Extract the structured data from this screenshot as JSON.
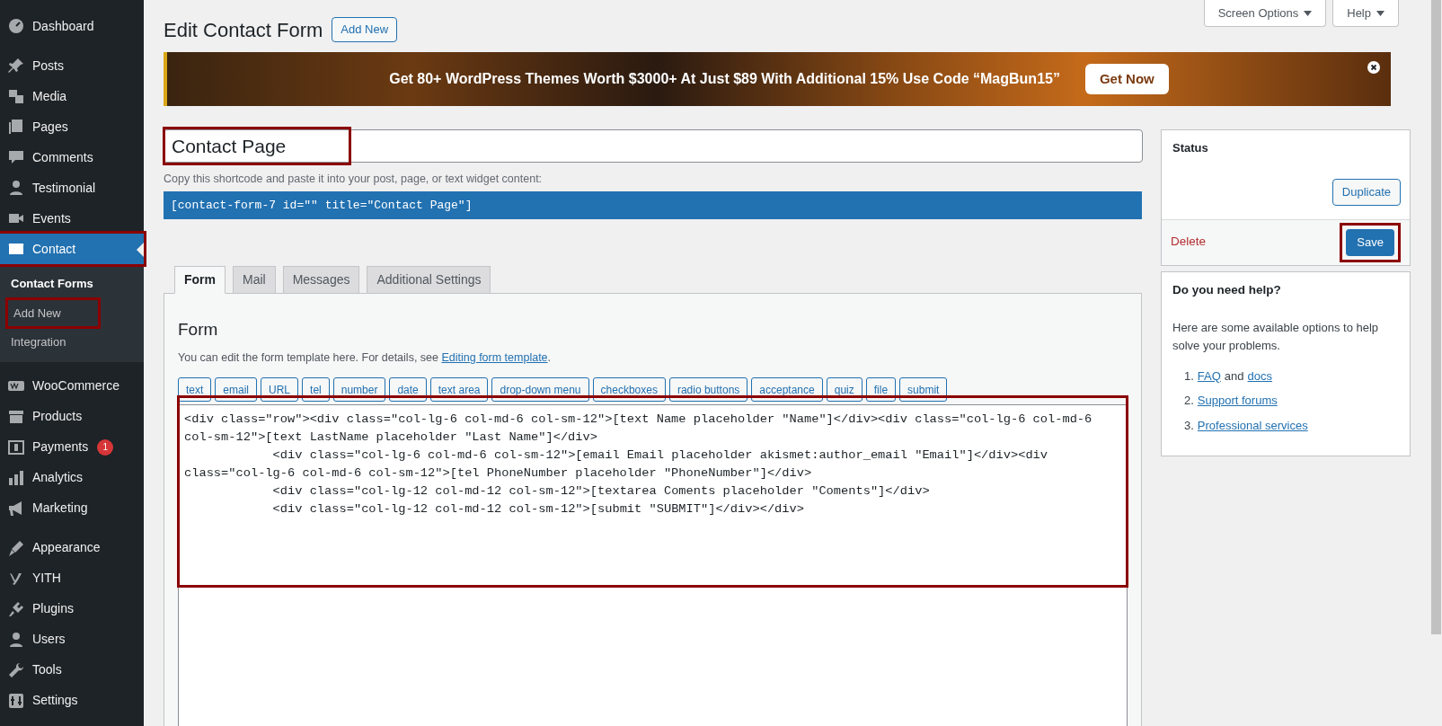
{
  "sidebar": {
    "groups": [
      [
        {
          "label": "Dashboard",
          "selected": false,
          "highlighted": false
        }
      ],
      [
        {
          "label": "Posts",
          "selected": false,
          "highlighted": false
        },
        {
          "label": "Media",
          "selected": false,
          "highlighted": false
        },
        {
          "label": "Pages",
          "selected": false,
          "highlighted": false
        },
        {
          "label": "Comments",
          "selected": false,
          "highlighted": false
        },
        {
          "label": "Testimonial",
          "selected": false,
          "highlighted": false
        },
        {
          "label": "Events",
          "selected": false,
          "highlighted": false
        },
        {
          "label": "Contact",
          "selected": true,
          "highlighted": true,
          "children": [
            {
              "label": "Contact Forms",
              "selected": true,
              "highlighted": false
            },
            {
              "label": "Add New",
              "selected": false,
              "highlighted": true
            },
            {
              "label": "Integration",
              "selected": false,
              "highlighted": false
            }
          ]
        }
      ],
      [
        {
          "label": "WooCommerce",
          "selected": false,
          "highlighted": false
        },
        {
          "label": "Products",
          "selected": false,
          "highlighted": false
        },
        {
          "label": "Payments",
          "selected": false,
          "highlighted": false,
          "badge": "1"
        },
        {
          "label": "Analytics",
          "selected": false,
          "highlighted": false
        },
        {
          "label": "Marketing",
          "selected": false,
          "highlighted": false
        }
      ],
      [
        {
          "label": "Appearance",
          "selected": false,
          "highlighted": false
        },
        {
          "label": "YITH",
          "selected": false,
          "highlighted": false
        },
        {
          "label": "Plugins",
          "selected": false,
          "highlighted": false
        },
        {
          "label": "Users",
          "selected": false,
          "highlighted": false
        },
        {
          "label": "Tools",
          "selected": false,
          "highlighted": false
        },
        {
          "label": "Settings",
          "selected": false,
          "highlighted": false
        }
      ]
    ]
  },
  "header": {
    "title": "Edit Contact Form",
    "add_new": "Add New",
    "screen_options": "Screen Options",
    "help": "Help"
  },
  "banner": {
    "text": "Get 80+ WordPress Themes Worth $3000+ At Just $89 With Additional 15% Use Code “MagBun15”",
    "button": "Get Now"
  },
  "title_field": {
    "value": "Contact Page",
    "highlighted": true
  },
  "shortcode": {
    "hint": "Copy this shortcode and paste it into your post, page, or text widget content:",
    "code": "[contact-form-7 id=\"\" title=\"Contact Page\"]"
  },
  "tabs": [
    {
      "label": "Form",
      "selected": true
    },
    {
      "label": "Mail",
      "selected": false
    },
    {
      "label": "Messages",
      "selected": false
    },
    {
      "label": "Additional Settings",
      "selected": false
    }
  ],
  "form_panel": {
    "heading": "Form",
    "description": "You can edit the form template here. For details, see ",
    "link": "Editing form template",
    "after_link": ".",
    "tag_buttons": [
      "text",
      "email",
      "URL",
      "tel",
      "number",
      "date",
      "text area",
      "drop-down menu",
      "checkboxes",
      "radio buttons",
      "acceptance",
      "quiz",
      "file",
      "submit"
    ],
    "template": "<div class=\"row\"><div class=\"col-lg-6 col-md-6 col-sm-12\">[text Name placeholder \"Name\"]</div><div class=\"col-lg-6 col-md-6 col-sm-12\">[text LastName placeholder \"Last Name\"]</div>\n            <div class=\"col-lg-6 col-md-6 col-sm-12\">[email Email placeholder akismet:author_email \"Email\"]</div><div class=\"col-lg-6 col-md-6 col-sm-12\">[tel PhoneNumber placeholder \"PhoneNumber\"]</div>\n            <div class=\"col-lg-12 col-md-12 col-sm-12\">[textarea Coments placeholder \"Coments\"]</div>\n            <div class=\"col-lg-12 col-md-12 col-sm-12\">[submit \"SUBMIT\"]</div></div>",
    "highlighted": true
  },
  "status_box": {
    "title": "Status",
    "duplicate": "Duplicate",
    "delete": "Delete",
    "save": "Save",
    "save_highlighted": true
  },
  "help_box": {
    "title": "Do you need help?",
    "text": "Here are some available options to help solve your problems.",
    "items": [
      {
        "number": "1.",
        "parts": [
          {
            "text": "FAQ",
            "link": true
          },
          {
            "text": "and",
            "link": false
          },
          {
            "text": "docs",
            "link": true
          }
        ]
      },
      {
        "number": "2.",
        "parts": [
          {
            "text": "Support forums",
            "link": true
          }
        ]
      },
      {
        "number": "3.",
        "parts": [
          {
            "text": "Professional services",
            "link": true
          }
        ]
      }
    ]
  }
}
